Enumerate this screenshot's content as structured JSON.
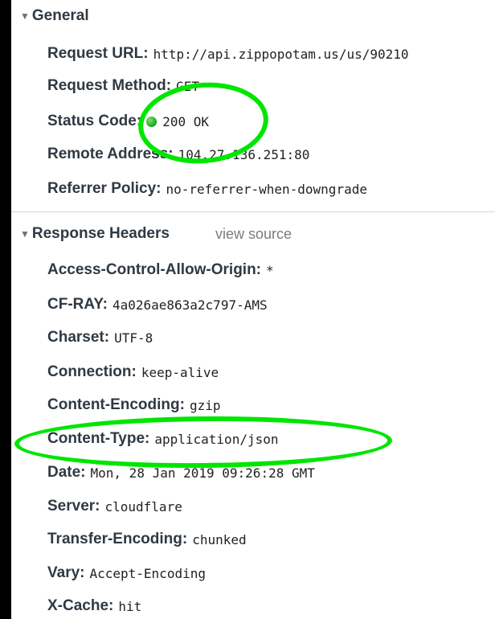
{
  "general": {
    "title": "General",
    "rows": [
      {
        "key": "Request URL:",
        "value": "http://api.zippopotam.us/us/90210"
      },
      {
        "key": "Request Method:",
        "value": "GET"
      },
      {
        "key": "Status Code:",
        "value": "200 OK"
      },
      {
        "key": "Remote Address:",
        "value": "104.27.136.251:80"
      },
      {
        "key": "Referrer Policy:",
        "value": "no-referrer-when-downgrade"
      }
    ]
  },
  "response_headers": {
    "title": "Response Headers",
    "view_source": "view source",
    "rows": [
      {
        "key": "Access-Control-Allow-Origin:",
        "value": "*"
      },
      {
        "key": "CF-RAY:",
        "value": "4a026ae863a2c797-AMS"
      },
      {
        "key": "Charset:",
        "value": "UTF-8"
      },
      {
        "key": "Connection:",
        "value": "keep-alive"
      },
      {
        "key": "Content-Encoding:",
        "value": "gzip"
      },
      {
        "key": "Content-Type:",
        "value": "application/json"
      },
      {
        "key": "Date:",
        "value": "Mon, 28 Jan 2019 09:26:28 GMT"
      },
      {
        "key": "Server:",
        "value": "cloudflare"
      },
      {
        "key": "Transfer-Encoding:",
        "value": "chunked"
      },
      {
        "key": "Vary:",
        "value": "Accept-Encoding"
      },
      {
        "key": "X-Cache:",
        "value": "hit"
      }
    ]
  },
  "colors": {
    "status_ok": "#13a313",
    "annotation": "#00e600",
    "key_text": "#303942"
  }
}
